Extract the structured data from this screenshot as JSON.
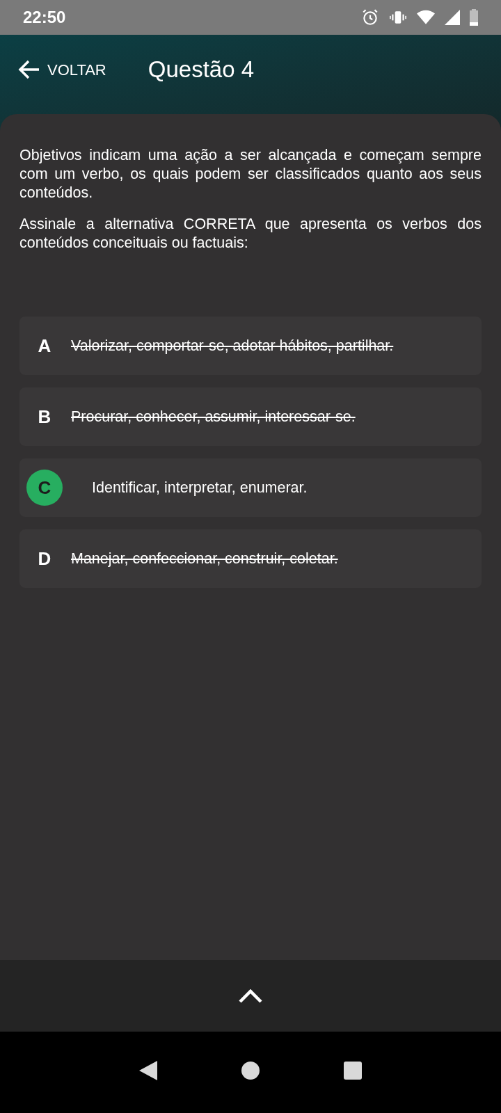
{
  "status_bar": {
    "time": "22:50"
  },
  "header": {
    "back_label": "VOLTAR",
    "title": "Questão 4"
  },
  "question": {
    "paragraphs": [
      "Objetivos indicam uma ação a ser alcançada e começam sempre com um verbo, os quais podem ser classificados quanto aos seus conteúdos.",
      "Assinale a alternativa CORRETA que apresenta os verbos dos conteúdos conceituais ou factuais:"
    ]
  },
  "options": [
    {
      "letter": "A",
      "text": "Valorizar, comportar-se, adotar hábitos, partilhar.",
      "selected": false,
      "struck": true
    },
    {
      "letter": "B",
      "text": "Procurar, conhecer, assumir, interessar-se.",
      "selected": false,
      "struck": true
    },
    {
      "letter": "C",
      "text": "Identificar, interpretar, enumerar.",
      "selected": true,
      "struck": false
    },
    {
      "letter": "D",
      "text": "Manejar, confeccionar, construir, coletar.",
      "selected": false,
      "struck": true
    }
  ]
}
